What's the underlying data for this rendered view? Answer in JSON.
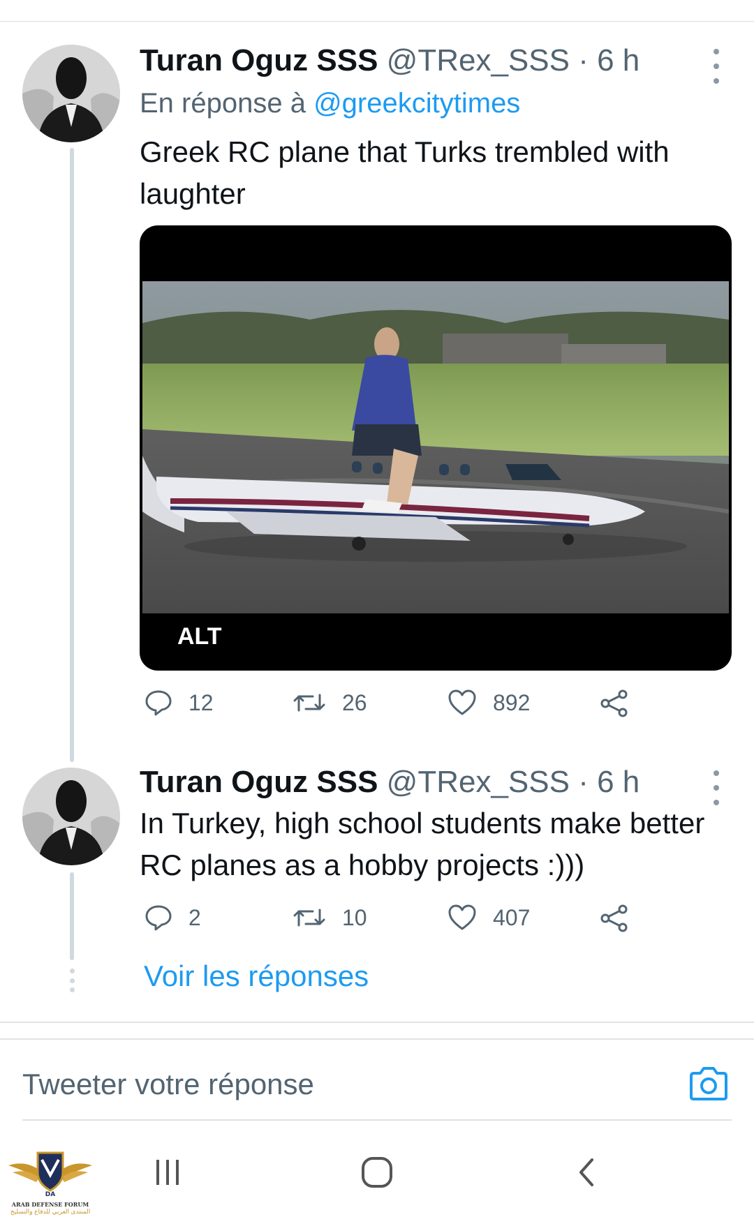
{
  "tweets": [
    {
      "author_name": "Turan Oguz SSS",
      "handle": "@TRex_SSS",
      "separator": "·",
      "time": "6 h",
      "reply_prefix": "En réponse à",
      "reply_to": "@greekcitytimes",
      "text": "Greek RC plane that Turks trembled with laughter",
      "media": {
        "alt_badge": "ALT"
      },
      "stats": {
        "replies": "12",
        "retweets": "26",
        "likes": "892"
      }
    },
    {
      "author_name": "Turan Oguz SSS",
      "handle": "@TRex_SSS",
      "separator": "·",
      "time": "6 h",
      "text": "In Turkey, high school students make better RC planes as a hobby projects :)))",
      "stats": {
        "replies": "2",
        "retweets": "10",
        "likes": "407"
      }
    }
  ],
  "thread": {
    "show_replies": "Voir les réponses"
  },
  "compose": {
    "placeholder": "Tweeter votre réponse"
  },
  "watermark": {
    "title": "ARAB DEFENSE FORUM",
    "monogram": "DA",
    "subtitle": "المنتدى العربي للدفاع والتسليح"
  },
  "colors": {
    "accent": "#1d9bf0",
    "secondary_text": "#536471",
    "thread_line": "#cfd9de"
  }
}
